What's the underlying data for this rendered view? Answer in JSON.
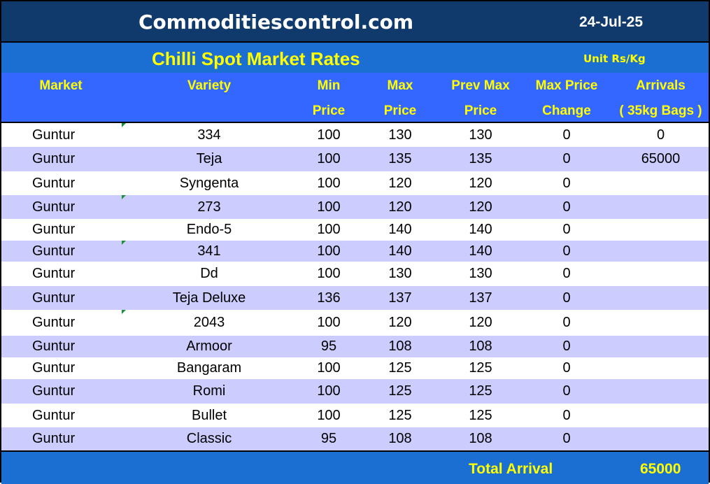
{
  "header": {
    "site_title": "Commoditiescontrol.com",
    "date": "24-Jul-25",
    "report_title": "Chilli Spot Market Rates",
    "unit": "Unit Rs/Kg"
  },
  "columns": [
    {
      "line1": "Market",
      "line2": ""
    },
    {
      "line1": "Variety",
      "line2": ""
    },
    {
      "line1": "Min",
      "line2": "Price"
    },
    {
      "line1": "Max",
      "line2": "Price"
    },
    {
      "line1": "Prev Max",
      "line2": "Price"
    },
    {
      "line1": "Max Price",
      "line2": "Change"
    },
    {
      "line1": "Arrivals",
      "line2": "( 35kg Bags )"
    }
  ],
  "rows": [
    {
      "market": "Guntur",
      "variety": "334",
      "min": "100",
      "max": "130",
      "prev_max": "130",
      "change": "0",
      "arrivals": "0"
    },
    {
      "market": "Guntur",
      "variety": "Teja",
      "min": "100",
      "max": "135",
      "prev_max": "135",
      "change": "0",
      "arrivals": "65000"
    },
    {
      "market": "Guntur",
      "variety": "Syngenta",
      "min": "100",
      "max": "120",
      "prev_max": "120",
      "change": "0",
      "arrivals": ""
    },
    {
      "market": "Guntur",
      "variety": "273",
      "min": "100",
      "max": "120",
      "prev_max": "120",
      "change": "0",
      "arrivals": ""
    },
    {
      "market": "Guntur",
      "variety": "Endo-5",
      "min": "100",
      "max": "140",
      "prev_max": "140",
      "change": "0",
      "arrivals": ""
    },
    {
      "market": "Guntur",
      "variety": "341",
      "min": "100",
      "max": "140",
      "prev_max": "140",
      "change": "0",
      "arrivals": ""
    },
    {
      "market": "Guntur",
      "variety": "Dd",
      "min": "100",
      "max": "130",
      "prev_max": "130",
      "change": "0",
      "arrivals": ""
    },
    {
      "market": "Guntur",
      "variety": "Teja Deluxe",
      "min": "136",
      "max": "137",
      "prev_max": "137",
      "change": "0",
      "arrivals": ""
    },
    {
      "market": "Guntur",
      "variety": "2043",
      "min": "100",
      "max": "120",
      "prev_max": "120",
      "change": "0",
      "arrivals": ""
    },
    {
      "market": "Guntur",
      "variety": "Armoor",
      "min": "95",
      "max": "108",
      "prev_max": "108",
      "change": "0",
      "arrivals": ""
    },
    {
      "market": "Guntur",
      "variety": "Bangaram",
      "min": "100",
      "max": "125",
      "prev_max": "125",
      "change": "0",
      "arrivals": ""
    },
    {
      "market": "Guntur",
      "variety": "Romi",
      "min": "100",
      "max": "125",
      "prev_max": "125",
      "change": "0",
      "arrivals": ""
    },
    {
      "market": "Guntur",
      "variety": "Bullet",
      "min": "100",
      "max": "125",
      "prev_max": "125",
      "change": "0",
      "arrivals": ""
    },
    {
      "market": "Guntur",
      "variety": "Classic",
      "min": "95",
      "max": "108",
      "prev_max": "108",
      "change": "0",
      "arrivals": ""
    }
  ],
  "footer": {
    "total_label": "Total Arrival",
    "total_value": "65000"
  },
  "colors": {
    "title_bar": "#0f3a6b",
    "sub_bar": "#1c6fd2",
    "header_bar": "#3367ff",
    "header_text": "#ffff00",
    "alt_row": "#ccccff"
  }
}
